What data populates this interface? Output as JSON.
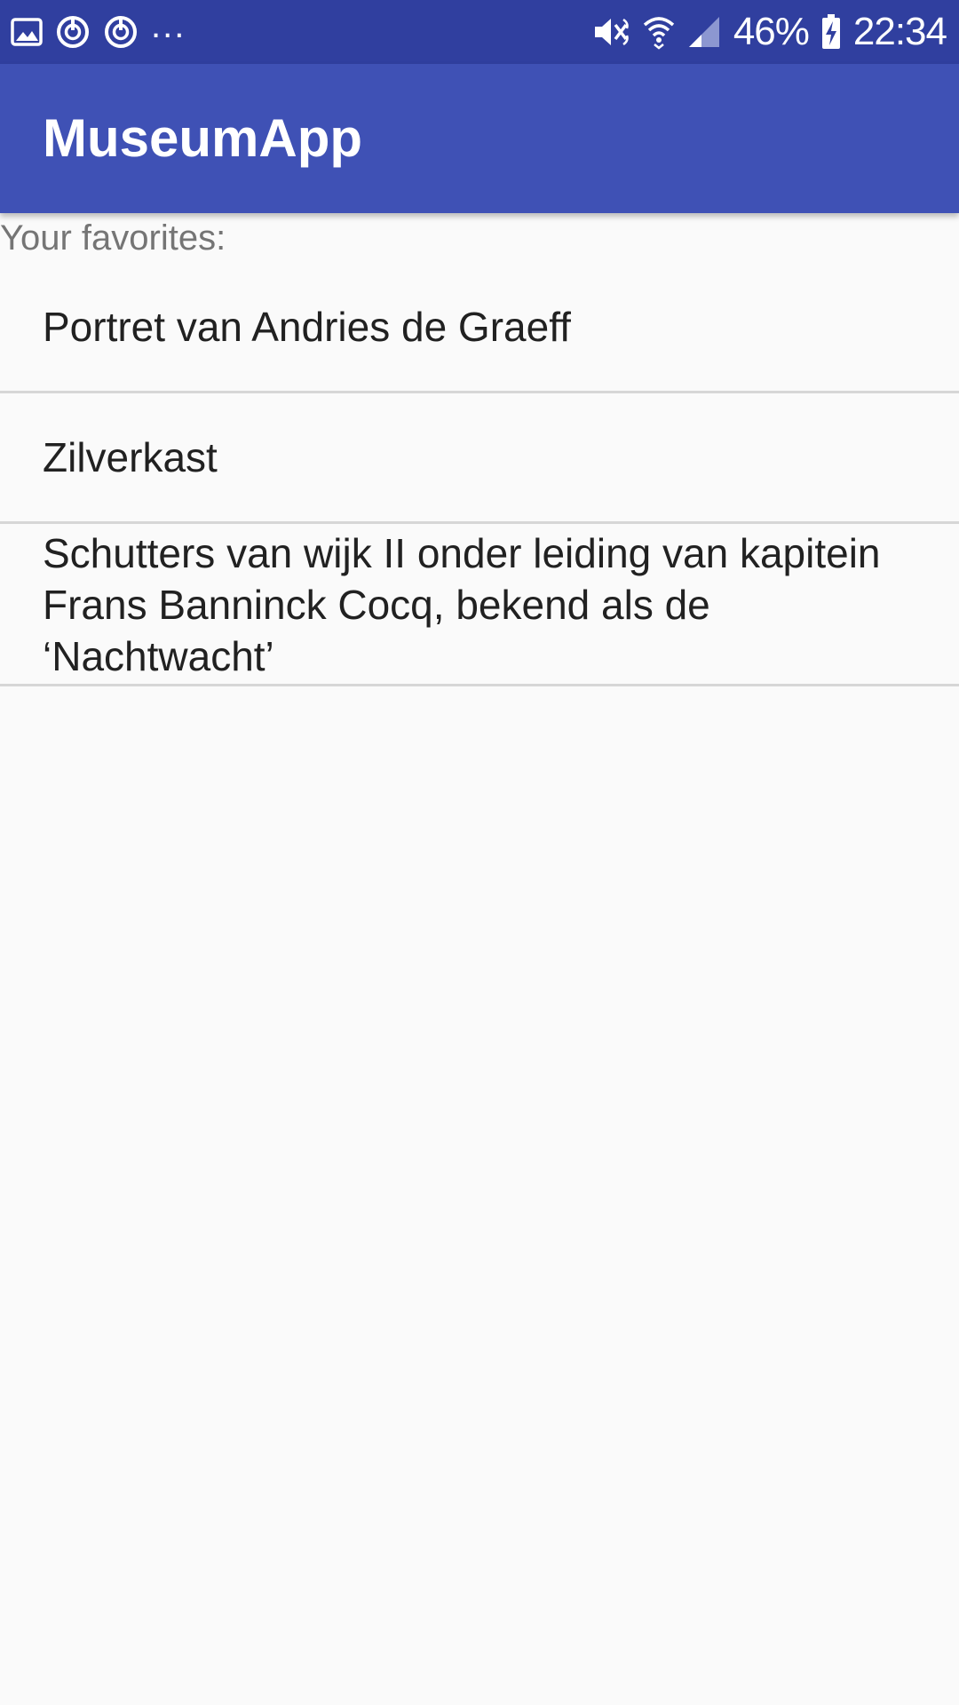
{
  "status_bar": {
    "left_icons": [
      "gallery-icon",
      "sync-icon",
      "sync-icon"
    ],
    "more": "...",
    "right_icons": [
      "mute-icon",
      "wifi-icon",
      "signal-icon",
      "battery-charging-icon"
    ],
    "battery": "46%",
    "time": "22:34"
  },
  "app_bar": {
    "title": "MuseumApp",
    "color": "#3f51b5",
    "status_color": "#303f9f"
  },
  "favorites": {
    "label": "Your favorites:",
    "items": [
      {
        "title": "Portret van Andries de Graeff"
      },
      {
        "title": "Zilverkast"
      },
      {
        "title": "Schutters van wijk II onder leiding van kapitein Frans Banninck Cocq, bekend als de ‘Nachtwacht’"
      }
    ]
  }
}
